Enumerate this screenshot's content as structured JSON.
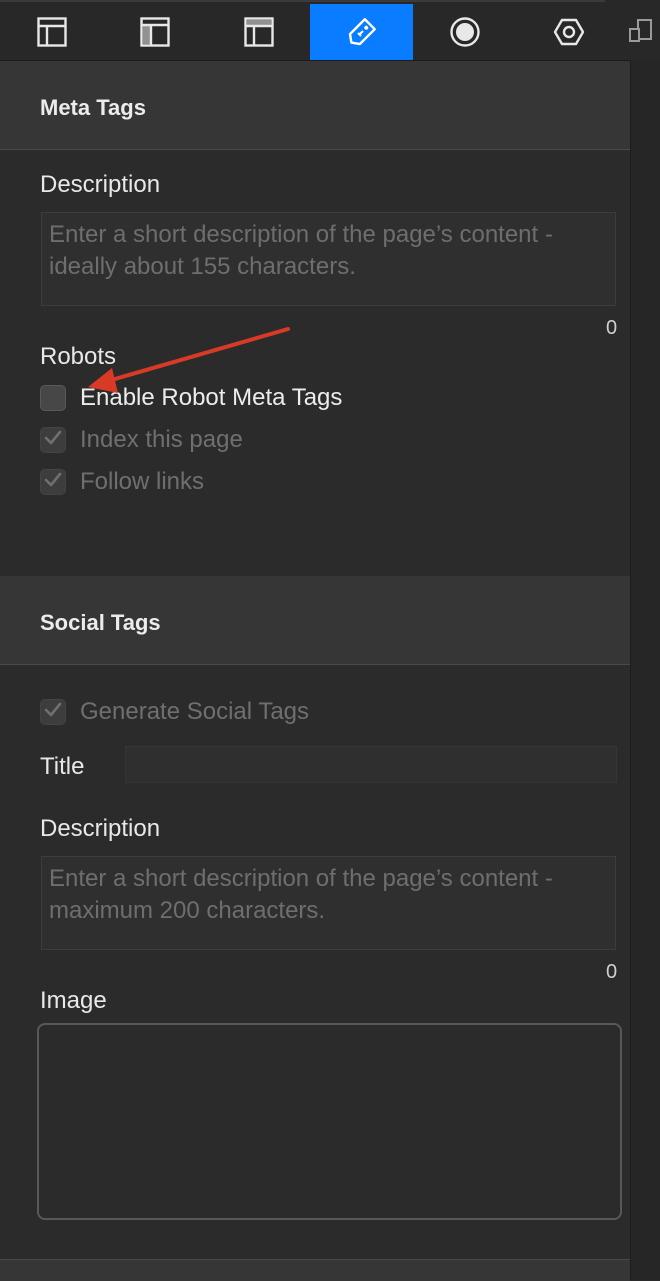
{
  "toolbar": {
    "tabs": [
      {
        "icon": "layout-icon",
        "active": false
      },
      {
        "icon": "sidebar-layout-icon",
        "active": false
      },
      {
        "icon": "header-layout-icon",
        "active": false
      },
      {
        "icon": "tag-icon",
        "active": true
      },
      {
        "icon": "target-icon",
        "active": false
      },
      {
        "icon": "hexagon-settings-icon",
        "active": false
      }
    ],
    "right_icon": "devices-icon",
    "accent_color": "#0a7cff"
  },
  "meta_tags": {
    "title": "Meta Tags",
    "description_label": "Description",
    "description_placeholder": "Enter a short description of the page’s content - ideally about 155 characters.",
    "description_count": "0",
    "robots_label": "Robots",
    "enable_robots": {
      "label": "Enable Robot Meta Tags",
      "checked": false
    },
    "index_page": {
      "label": "Index this page",
      "checked": true,
      "disabled": true
    },
    "follow_links": {
      "label": "Follow links",
      "checked": true,
      "disabled": true
    }
  },
  "social_tags": {
    "title": "Social Tags",
    "generate": {
      "label": "Generate Social Tags",
      "checked": true,
      "disabled": true
    },
    "title_label": "Title",
    "title_value": "",
    "description_label": "Description",
    "description_placeholder": "Enter a short description of the page’s content - maximum 200 characters.",
    "description_count": "0",
    "image_label": "Image"
  },
  "annotation_color": "#d93a26"
}
